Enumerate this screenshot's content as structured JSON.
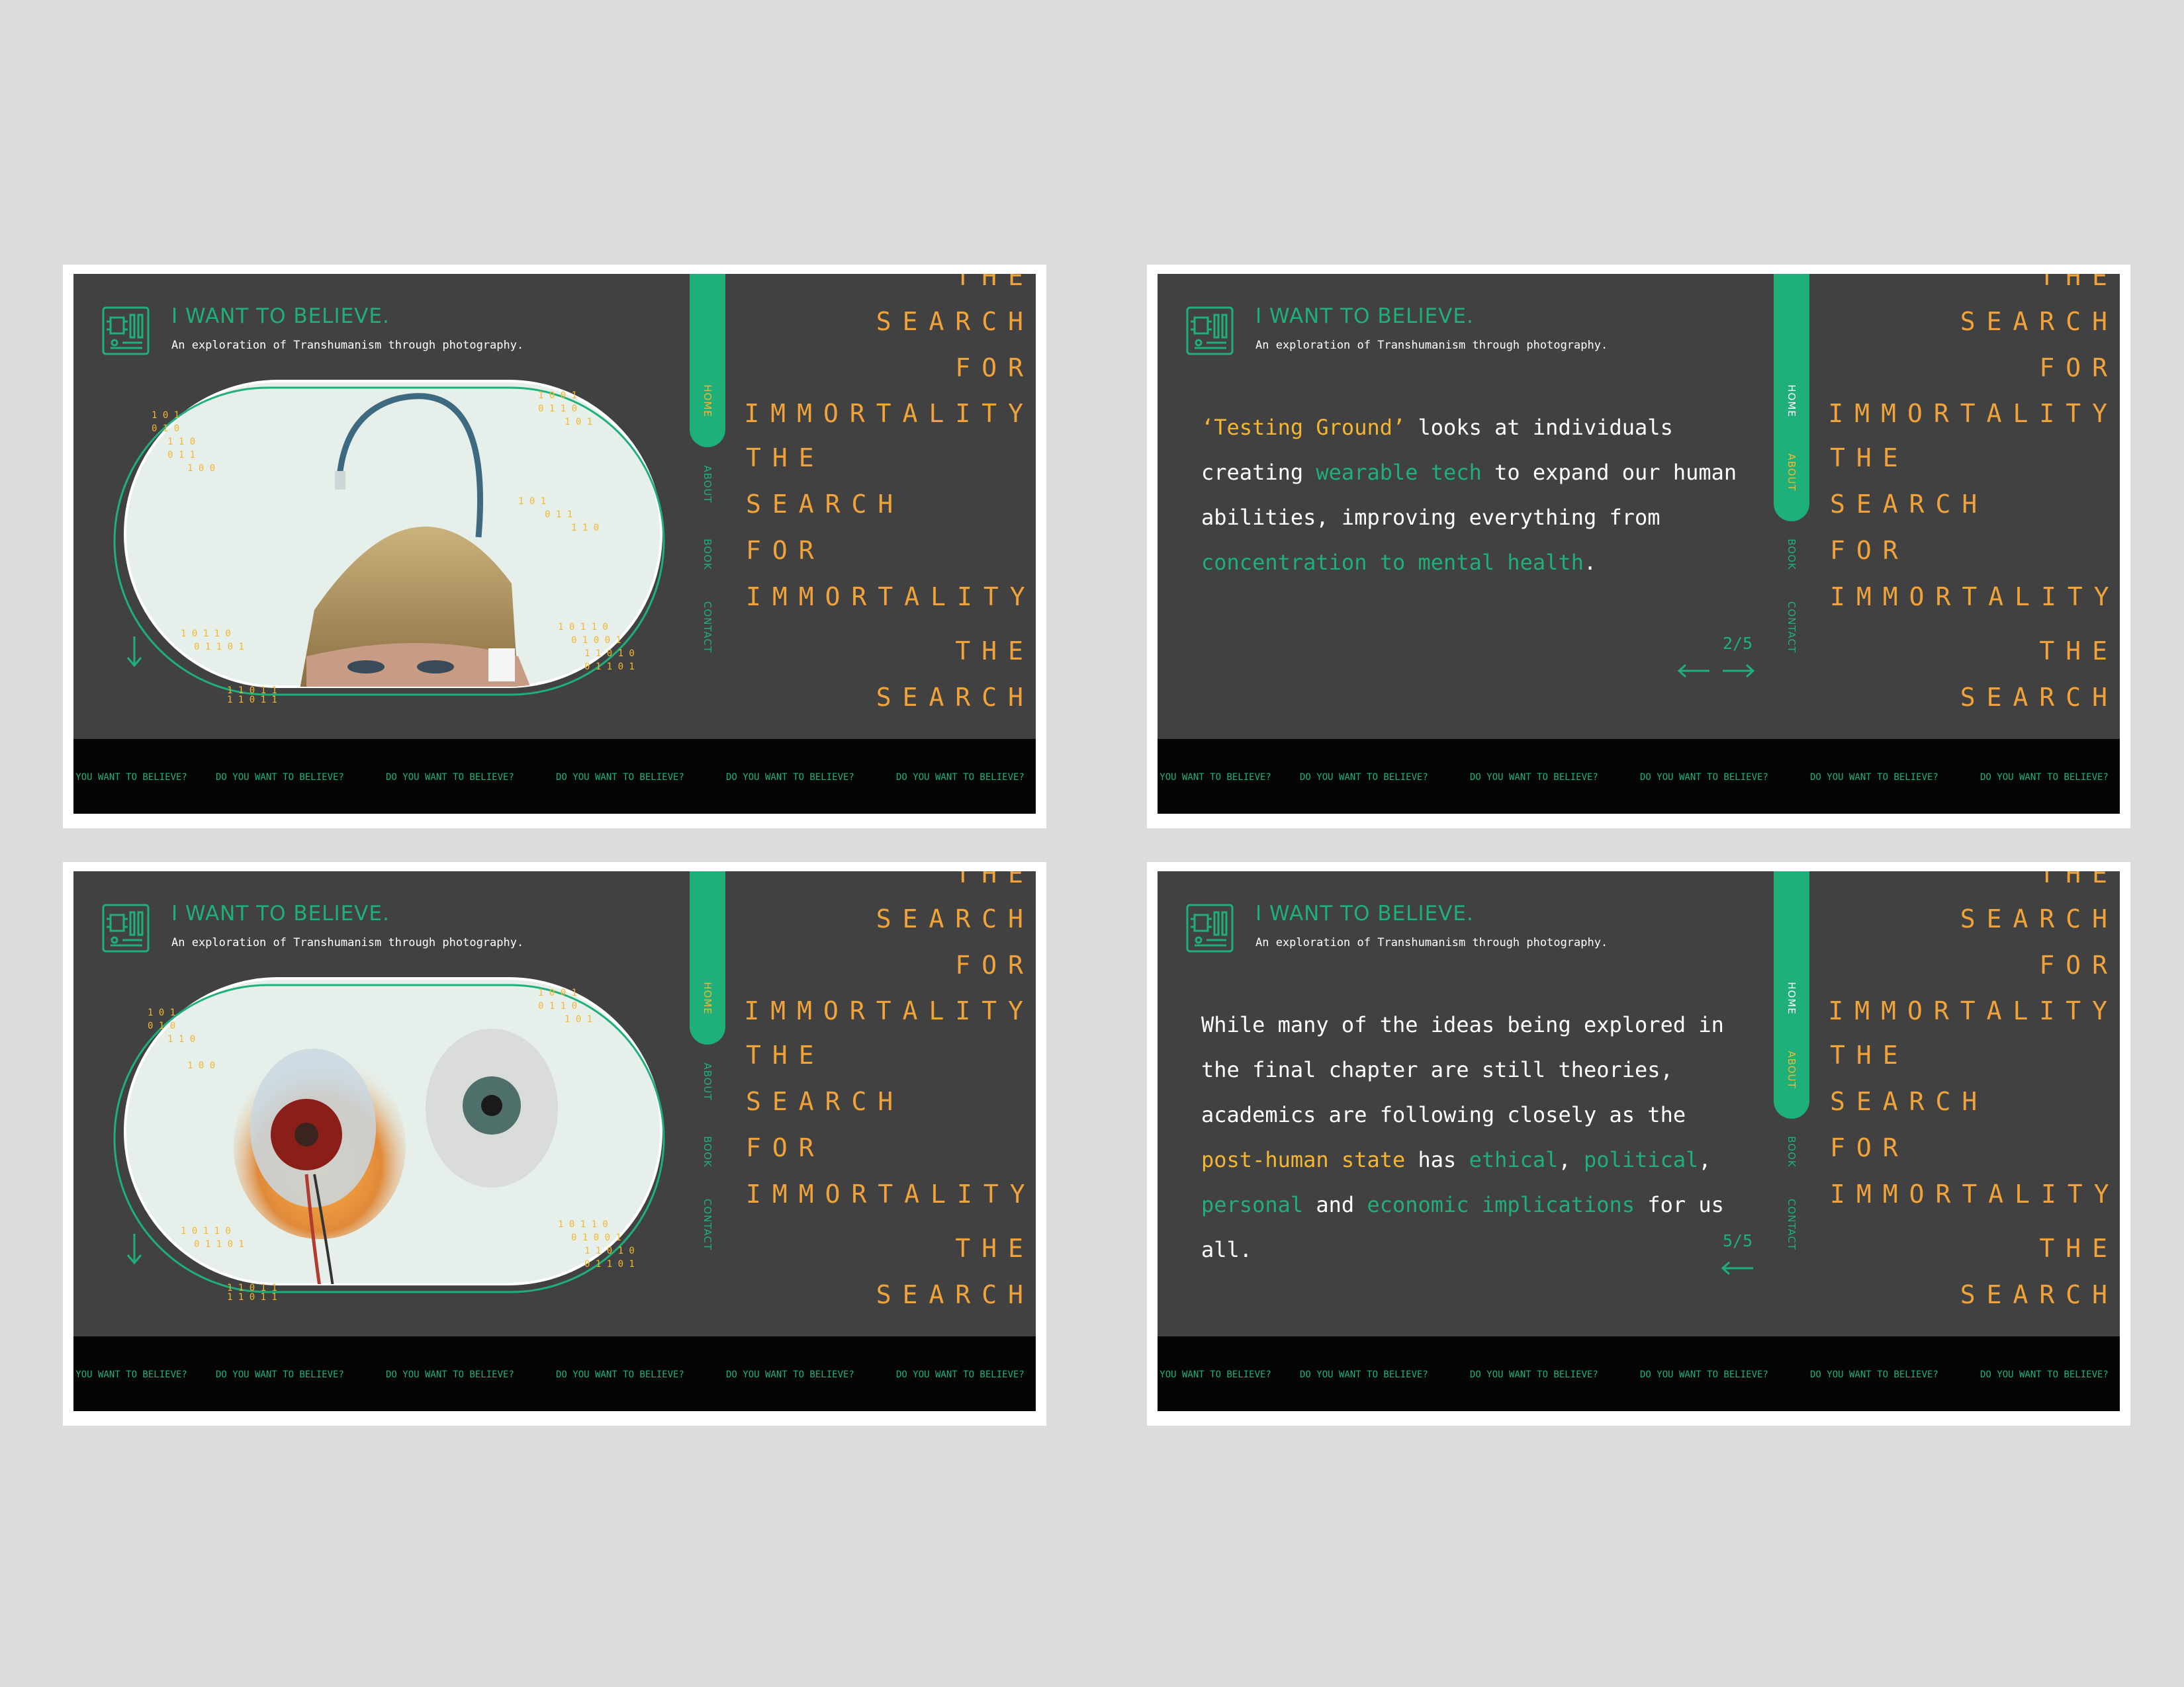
{
  "slides": [
    {
      "title": "I WANT TO BELIEVE.",
      "subtitle": "An exploration of Transhumanism through photography.",
      "nav": {
        "home": "HOME",
        "about": "ABOUT",
        "book": "BOOK",
        "contact": "CONTACT"
      },
      "vertical_words": [
        "THE",
        "SEARCH",
        "FOR",
        "IMMORTALITY",
        "THE",
        "SEARCH",
        "FOR",
        "IMMORTALITY",
        "THE",
        "SEARCH"
      ],
      "ticker": [
        "DO YOU WANT TO BELIEVE?",
        "DO YOU WANT TO BELIEVE?",
        "DO YOU WANT TO BELIEVE?",
        "DO YOU WANT TO BELIEVE?",
        "DO YOU WANT TO BELIEVE?",
        "DO YOU WANT TO BELIEVE?"
      ],
      "photo_subject": "bowl-cut head with antenna implant"
    },
    {
      "title": "I WANT TO BELIEVE.",
      "subtitle": "An exploration of Transhumanism through photography.",
      "nav": {
        "home": "HOME",
        "about": "ABOUT",
        "book": "BOOK",
        "contact": "CONTACT"
      },
      "vertical_words": [
        "THE",
        "SEARCH",
        "FOR",
        "IMMORTALITY",
        "THE",
        "SEARCH",
        "FOR",
        "IMMORTALITY",
        "THE",
        "SEARCH"
      ],
      "ticker": [
        "DO YOU WANT TO BELIEVE?",
        "DO YOU WANT TO BELIEVE?",
        "DO YOU WANT TO BELIEVE?",
        "DO YOU WANT TO BELIEVE?",
        "DO YOU WANT TO BELIEVE?",
        "DO YOU WANT TO BELIEVE?"
      ],
      "story": {
        "p1": "‘Testing Ground’",
        "p2": " looks at individuals creating ",
        "p3": "wearable tech",
        "p4": " to expand our human abilities, improving everything from ",
        "p5": "concentration to mental health",
        "p6": "."
      },
      "pager": "2/5"
    },
    {
      "title": "I WANT TO BELIEVE.",
      "subtitle": "An exploration of Transhumanism through photography.",
      "nav": {
        "home": "HOME",
        "about": "ABOUT",
        "book": "BOOK",
        "contact": "CONTACT"
      },
      "vertical_words": [
        "THE",
        "SEARCH",
        "FOR",
        "IMMORTALITY",
        "THE",
        "SEARCH",
        "FOR",
        "IMMORTALITY",
        "THE",
        "SEARCH"
      ],
      "ticker": [
        "DO YOU WANT TO BELIEVE?",
        "DO YOU WANT TO BELIEVE?",
        "DO YOU WANT TO BELIEVE?",
        "DO YOU WANT TO BELIEVE?",
        "DO YOU WANT TO BELIEVE?",
        "DO YOU WANT TO BELIEVE?"
      ],
      "photo_subject": "prosthetic glowing eye and realistic eyeball"
    },
    {
      "title": "I WANT TO BELIEVE.",
      "subtitle": "An exploration of Transhumanism through photography.",
      "nav": {
        "home": "HOME",
        "about": "ABOUT",
        "book": "BOOK",
        "contact": "CONTACT"
      },
      "vertical_words": [
        "THE",
        "SEARCH",
        "FOR",
        "IMMORTALITY",
        "THE",
        "SEARCH",
        "FOR",
        "IMMORTALITY",
        "THE",
        "SEARCH"
      ],
      "ticker": [
        "DO YOU WANT TO BELIEVE?",
        "DO YOU WANT TO BELIEVE?",
        "DO YOU WANT TO BELIEVE?",
        "DO YOU WANT TO BELIEVE?",
        "DO YOU WANT TO BELIEVE?",
        "DO YOU WANT TO BELIEVE?"
      ],
      "story": {
        "p1": "While many of the ideas being explored in the final chapter are still theories, academics are following closely as the ",
        "p2": "post-human state",
        "p3": " has ",
        "p4": "ethical",
        "p5": ", ",
        "p6": "political",
        "p7": ", ",
        "p8": "personal",
        "p9": " and ",
        "p10": "economic implications",
        "p11": " for us all."
      },
      "pager": "5/5"
    }
  ],
  "colors": {
    "accent_green": "#1fb07a",
    "accent_orange": "#f0a33a",
    "highlight_yellow": "#f4b631",
    "screen_bg": "#414141",
    "ticker_bg": "#050505"
  },
  "icons": {
    "logo": "circuit-board-icon",
    "scroll": "arrow-down-icon",
    "prev": "arrow-left-icon",
    "next": "arrow-right-icon"
  }
}
